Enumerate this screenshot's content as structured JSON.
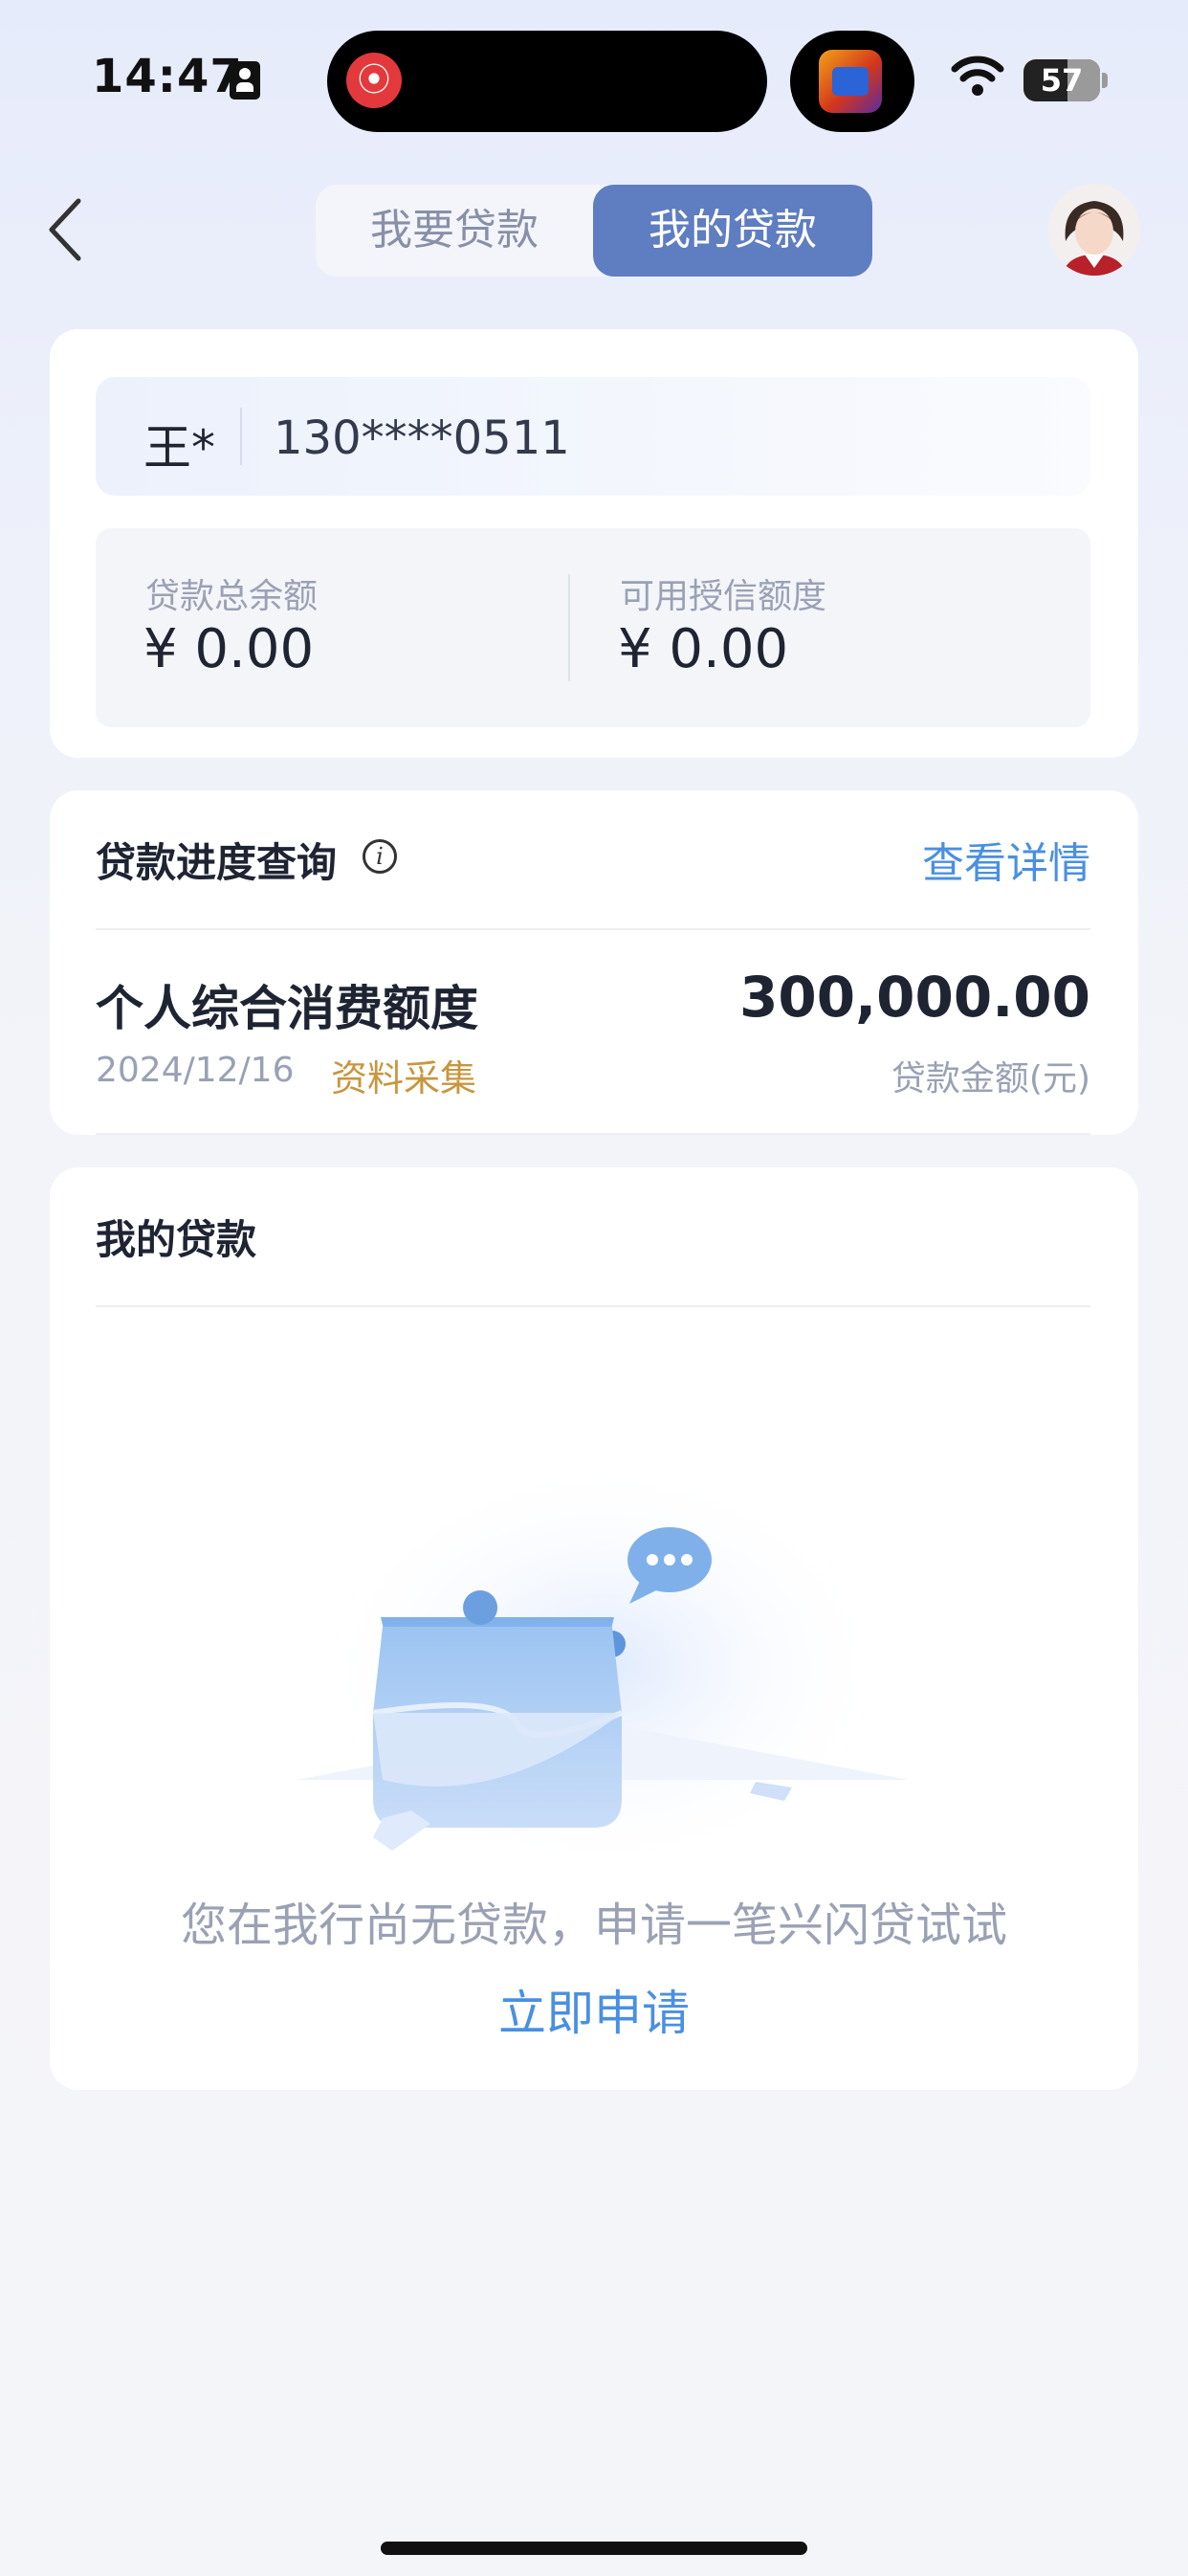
{
  "status_bar": {
    "time": "14:47",
    "battery": "57",
    "icons": [
      "id-card-icon",
      "netease-music-icon",
      "game-app-icon",
      "wifi-icon",
      "battery-icon"
    ]
  },
  "nav": {
    "tabs": [
      {
        "label": "我要贷款",
        "active": false
      },
      {
        "label": "我的贷款",
        "active": true
      }
    ],
    "back_icon": "chevron-left-icon",
    "avatar": "assistant-avatar"
  },
  "account": {
    "name": "王*",
    "phone": "130****0511",
    "total_balance_label": "贷款总余额",
    "total_balance_value": "¥ 0.00",
    "available_credit_label": "可用授信额度",
    "available_credit_value": "¥ 0.00"
  },
  "progress": {
    "title": "贷款进度查询",
    "info_icon": "i",
    "detail_link": "查看详情",
    "item": {
      "name": "个人综合消费额度",
      "date": "2024/12/16",
      "status": "资料采集",
      "amount": "300,000.00",
      "amount_label": "贷款金额(元)"
    }
  },
  "my_loans": {
    "title": "我的贷款",
    "empty_text": "您在我行尚无贷款，申请一笔兴闪贷试试",
    "apply_link": "立即申请"
  },
  "colors": {
    "accent": "#5f7dc1",
    "link": "#4a8fe2",
    "status": "#c8963e"
  }
}
